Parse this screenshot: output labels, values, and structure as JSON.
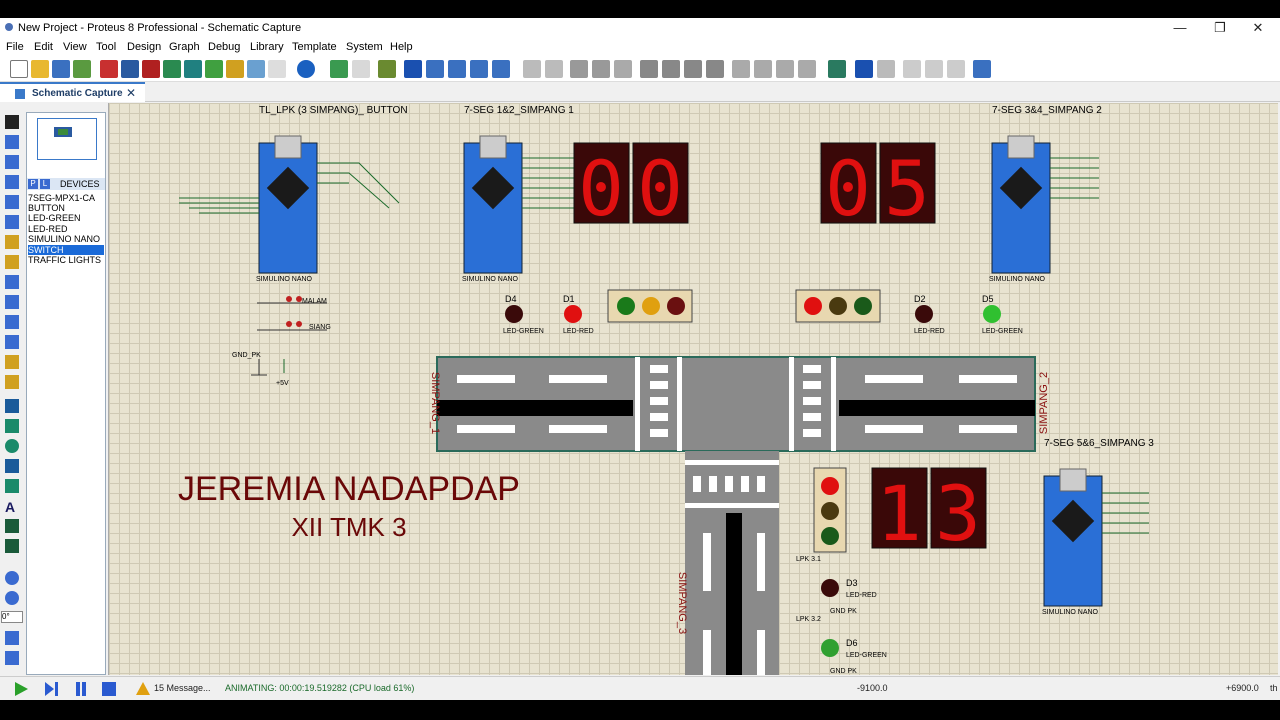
{
  "window": {
    "title": "New Project - Proteus 8 Professional - Schematic Capture"
  },
  "menu": [
    "File",
    "Edit",
    "View",
    "Tool",
    "Design",
    "Graph",
    "Debug",
    "Library",
    "Template",
    "System",
    "Help"
  ],
  "tab": {
    "label": "Schematic Capture"
  },
  "devices": {
    "header": "DEVICES",
    "mode_p": "P",
    "mode_l": "L",
    "items": [
      "7SEG-MPX1-CA",
      "BUTTON",
      "LED-GREEN",
      "LED-RED",
      "SIMULINO NANO",
      "SWITCH",
      "TRAFFIC LIGHTS"
    ],
    "selected": "SWITCH"
  },
  "rotation_field": "0°",
  "schematic": {
    "title_block_left": "TL_LPK (3 SIMPANG)_ BUTTON",
    "title_block_seg12": "7-SEG 1&2_SIMPANG 1",
    "title_block_seg34": "7-SEG 3&4_SIMPANG 2",
    "title_block_seg56": "7-SEG 5&6_SIMPANG 3",
    "nano_label": "SIMULINO NANO",
    "author": "JEREMIA NADAPDAP",
    "class": "XII TMK 3",
    "digits_s1": [
      "0",
      "0"
    ],
    "digits_s2": [
      "0",
      "5"
    ],
    "digits_s3": [
      "1",
      "3"
    ],
    "simpang_1": "SIMPANG_1",
    "simpang_2": "SIMPANG_2",
    "simpang_3": "SIMPANG_3",
    "led_d4": "D4",
    "led_d1": "D1",
    "led_d2": "D2",
    "led_d5": "D5",
    "led_d3": "D3",
    "led_d6": "D6",
    "led_green": "LED-GREEN",
    "led_red": "LED-RED",
    "sw_malam": "MALAM",
    "sw_siang": "SIANG",
    "gnd_pk": "GND_PK",
    "plus5v": "+5V",
    "lpk31": "LPK 3.1",
    "lpk32": "LPK 3.2",
    "gndpk2": "GND PK"
  },
  "status": {
    "messages": "15 Message...",
    "animating": "ANIMATING: 00:00:19.519282 (CPU load 61%)",
    "coord_x": "-9100.0",
    "coord_y": "+6900.0",
    "units": "th"
  },
  "colors": {
    "accent": "#3a79c9",
    "seg_on": "#e01010",
    "seg_bg": "#3a0808",
    "nano_blue": "#2a6fd6",
    "road": "#8a8a8a"
  }
}
